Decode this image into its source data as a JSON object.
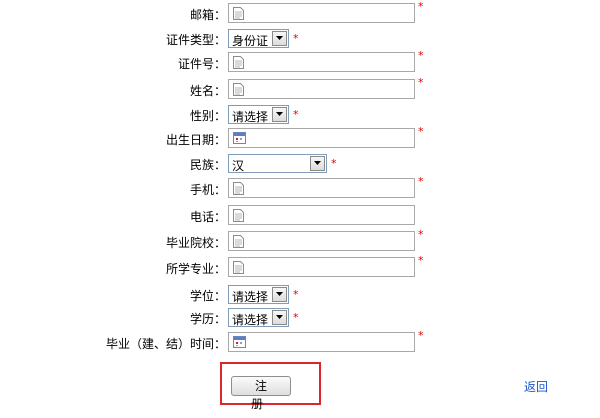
{
  "form": {
    "rows": [
      {
        "label": "邮箱：",
        "type": "text",
        "required": true
      },
      {
        "label": "证件类型：",
        "type": "select",
        "value": "身份证",
        "required": true
      },
      {
        "label": "证件号：",
        "type": "text",
        "required": true
      },
      {
        "label": "姓名：",
        "type": "text",
        "required": true
      },
      {
        "label": "性别：",
        "type": "select",
        "value": "请选择",
        "required": true
      },
      {
        "label": "出生日期：",
        "type": "date",
        "required": true
      },
      {
        "label": "民族：",
        "type": "select",
        "value": "汉",
        "required": true
      },
      {
        "label": "手机：",
        "type": "text",
        "required": true
      },
      {
        "label": "电话：",
        "type": "text",
        "required": false
      },
      {
        "label": "毕业院校：",
        "type": "text",
        "required": true
      },
      {
        "label": "所学专业：",
        "type": "text",
        "required": true
      },
      {
        "label": "学位：",
        "type": "select",
        "value": "请选择",
        "required": true
      },
      {
        "label": "学历：",
        "type": "select",
        "value": "请选择",
        "required": true
      },
      {
        "label": "毕业（建、结）时间：",
        "type": "date",
        "required": true
      }
    ],
    "required_mark": "*"
  },
  "actions": {
    "register_label": "注 册",
    "back_label": "返回"
  },
  "colors": {
    "required_star": "#e00000",
    "link": "#1a56c9",
    "highlight_border": "#d9272e",
    "input_border": "#a8a8a8"
  },
  "icons": {
    "text_field": "document-icon",
    "date_field": "calendar-icon",
    "dropdown": "chevron-down-icon"
  }
}
